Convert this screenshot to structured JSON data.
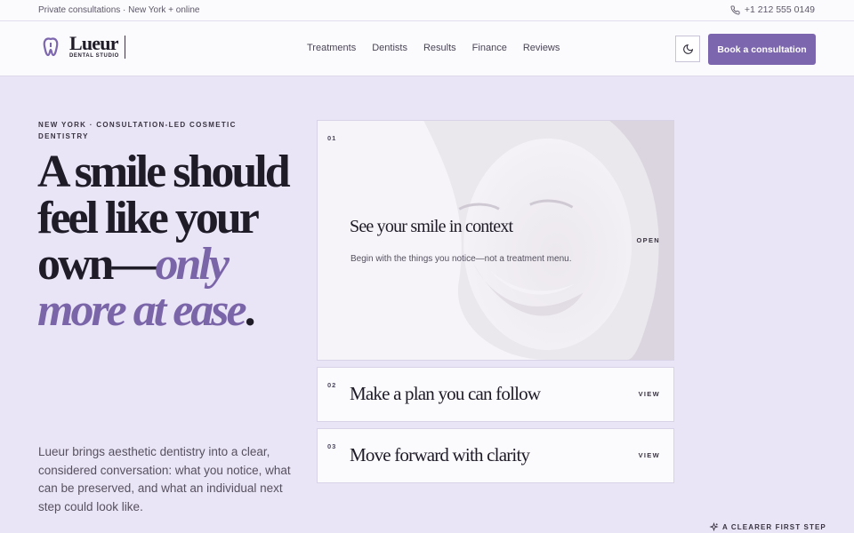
{
  "topbar": {
    "left_text": "Private consultations · New York + online",
    "phone": "+1 212 555 0149",
    "phone_icon": "phone-icon"
  },
  "nav": {
    "logo_name": "Lueur",
    "logo_sub": "DENTAL STUDIO",
    "links": [
      "Treatments",
      "Dentists",
      "Results",
      "Finance",
      "Reviews"
    ],
    "theme_icon": "moon-icon",
    "cta": "Book a consultation"
  },
  "hero": {
    "eyebrow": "NEW YORK · CONSULTATION-LED COSMETIC DENTISTRY",
    "headline_plain": "A smile should feel like your own—",
    "headline_accent": "only more at ease",
    "headline_end": ".",
    "lede": "Lueur brings aesthetic dentistry into a clear, considered conversation: what you notice, what can be preserved, and what an individual next step could look like."
  },
  "cards": [
    {
      "num": "01",
      "title": "See your smile in context",
      "desc": "Begin with the things you notice—not a treatment menu.",
      "action": "OPEN"
    },
    {
      "num": "02",
      "title": "Make a plan you can follow",
      "action": "VIEW"
    },
    {
      "num": "03",
      "title": "Move forward with clarity",
      "action": "VIEW"
    }
  ],
  "footer_tag": "A CLEARER FIRST STEP",
  "colors": {
    "accent": "#7c66ad",
    "background": "#e9e4f6",
    "ink": "#1f1b27"
  }
}
